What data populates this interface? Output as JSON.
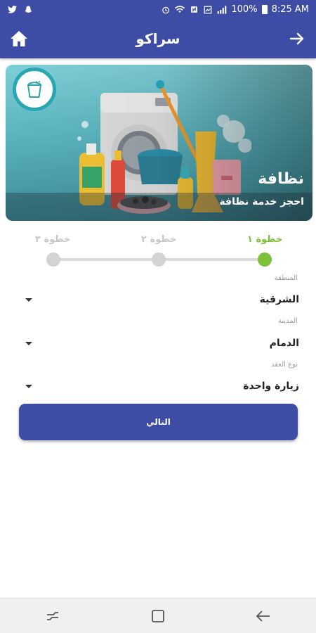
{
  "status_bar": {
    "battery": "100%",
    "time": "8:25 AM",
    "icons": [
      "twitter-icon",
      "snapchat-icon",
      "alarm-icon",
      "wifi-icon",
      "nfc-icon",
      "data-icon",
      "signal-icon",
      "battery-icon"
    ]
  },
  "app_bar": {
    "title": "سراكو",
    "left_icon": "home-icon",
    "right_icon": "arrow-right-icon"
  },
  "banner": {
    "title": "نظافة",
    "subtitle": "احجز خدمة نظافة",
    "badge_icon": "bucket-icon"
  },
  "stepper": {
    "steps": [
      {
        "label": "خطوة ١",
        "active": true
      },
      {
        "label": "خطوة ٢",
        "active": false
      },
      {
        "label": "خطوة ٣",
        "active": false
      }
    ]
  },
  "form": {
    "region": {
      "label": "المنطقة",
      "value": "الشرقية"
    },
    "city": {
      "label": "المدينة",
      "value": "الدمام"
    },
    "contract_type": {
      "label": "نوع العقد",
      "value": "زيارة واحدة"
    }
  },
  "next_button": {
    "label": "التالي"
  },
  "colors": {
    "primary": "#3f4ca5",
    "step_active": "#7dc13a",
    "step_inactive": "#d3d3d3",
    "badge_ring": "#28a6b3"
  }
}
